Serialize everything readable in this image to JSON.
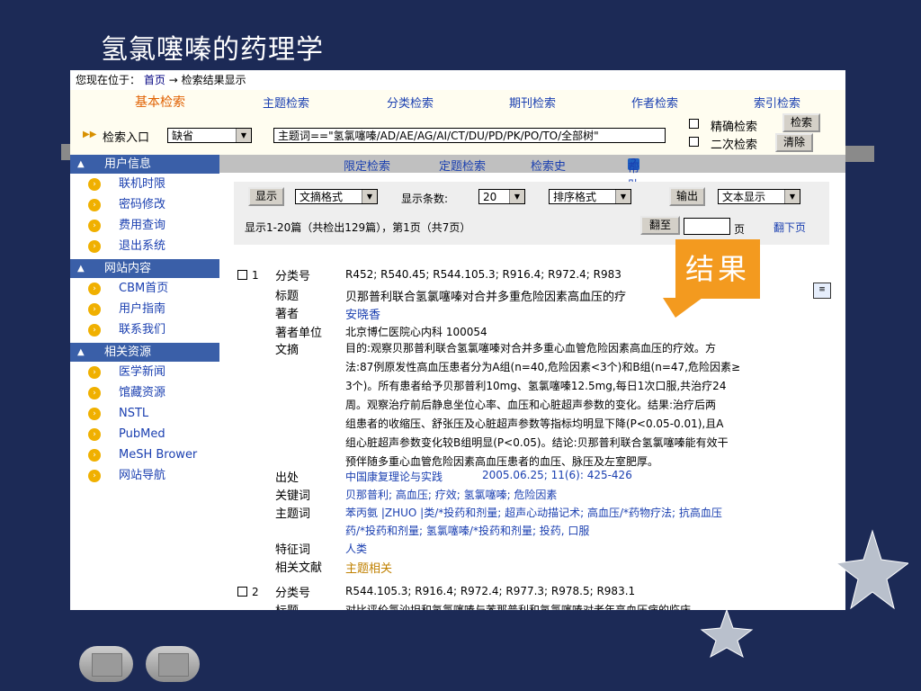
{
  "slide": {
    "title": "氢氯噻嗪的药理学"
  },
  "breadcrumb": {
    "prefix": "您现在位于：",
    "home": "首页",
    "arrow": "→",
    "current": "检索结果显示"
  },
  "nav": [
    "基本检索",
    "主题检索",
    "分类检索",
    "期刊检索",
    "作者检索",
    "索引检索"
  ],
  "entry": {
    "label": "检索入口",
    "field_value": "缺省",
    "query": "主题词==\"氢氯噻嗪/AD/AE/AG/AI/CT/DU/PD/PK/PO/TO/全部树\"",
    "exact_label": "精确检索",
    "second_label": "二次检索",
    "search_button": "检索",
    "clear_button": "清除"
  },
  "tabs": [
    "限定检索",
    "定题检索",
    "检索史",
    "帮助"
  ],
  "sidebar": {
    "sections": [
      {
        "title": "用户信息",
        "items": [
          "联机时限",
          "密码修改",
          "费用查询",
          "退出系统"
        ]
      },
      {
        "title": "网站内容",
        "items": [
          "CBM首页",
          "用户指南",
          "联系我们"
        ]
      },
      {
        "title": "相关资源",
        "items": [
          "医学新闻",
          "馆藏资源",
          "NSTL",
          "PubMed",
          "MeSH Brower",
          "网站导航"
        ]
      }
    ]
  },
  "toolbar": {
    "show_button": "显示",
    "format": "文摘格式",
    "count_label": "显示条数:",
    "count": "20",
    "sort": "排序格式",
    "output_button": "输出",
    "output_format": "文本显示",
    "summary": "显示1-20篇（共检出129篇），第1页（共7页）",
    "goto_button": "翻至",
    "page_unit": "页",
    "next_page": "翻下页"
  },
  "records": [
    {
      "num": "1",
      "class_label": "分类号",
      "class": "R452; R540.45; R544.105.3; R916.4; R972.4; R983",
      "title_label": "标题",
      "title": "贝那普利联合氢氯噻嗪对合并多重危险因素高血压的疗",
      "author_label": "著者",
      "author": "安晓香",
      "affil_label": "著者单位",
      "affil": "北京博仁医院心内科 100054",
      "abstract_label": "文摘",
      "abstract_lines": [
        "目的:观察贝那普利联合氢氯噻嗪对合并多重心血管危险因素高血压的疗效。方",
        "法:87例原发性高血压患者分为A组(n=40,危险因素<3个)和B组(n=47,危险因素≥",
        "3个)。所有患者给予贝那普利10mg、氢氯噻嗪12.5mg,每日1次口服,共治疗24",
        "周。观察治疗前后静息坐位心率、血压和心脏超声参数的变化。结果:治疗后两",
        "组患者的收缩压、舒张压及心脏超声参数等指标均明显下降(P<0.05-0.01),且A",
        "组心脏超声参数变化较B组明显(P<0.05)。结论:贝那普利联合氢氯噻嗪能有效干",
        "预伴随多重心血管危险因素高血压患者的血压、脉压及左室肥厚。"
      ],
      "source_label": "出处",
      "source": "中国康复理论与实践",
      "source_detail": "2005.06.25; 11(6): 425-426",
      "keywords_label": "关键词",
      "keywords": "贝那普利; 高血压; 疗效; 氢氯噻嗪; 危险因素",
      "subjects_label": "主题词",
      "subjects_line1": "苯丙氨 |ZHUO |类/*投药和剂量; 超声心动描记术; 高血压/*药物疗法; 抗高血压",
      "subjects_line2": "药/*投药和剂量; 氢氯噻嗪/*投药和剂量; 投药, 口服",
      "feature_label": "特征词",
      "feature": "人类",
      "related_label": "相关文献",
      "related": "主题相关"
    },
    {
      "num": "2",
      "class_label": "分类号",
      "class": "R544.105.3; R916.4; R972.4; R977.3; R978.5; R983.1",
      "title_label": "标题",
      "title": "对比评价氯沙坦和氢氯噻嗪与苯那普利和氢氯噻嗪对老年高血压病的临床"
    }
  ],
  "callout": {
    "text": "结果"
  }
}
